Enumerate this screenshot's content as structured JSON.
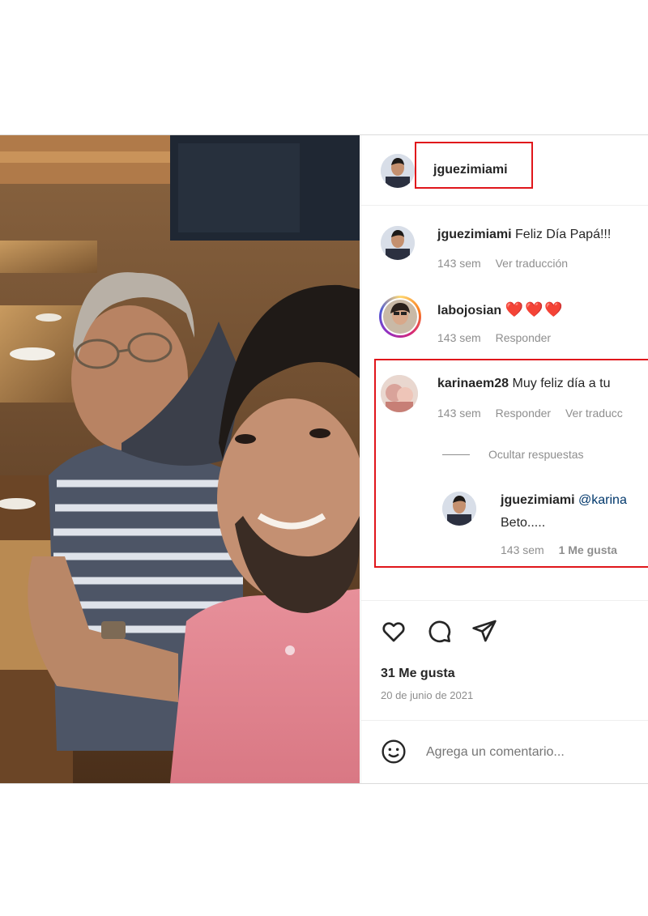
{
  "header": {
    "username": "jguezimiami"
  },
  "caption": {
    "username": "jguezimiami",
    "text": "Feliz Día Papá!!!",
    "time": "143 sem",
    "translate": "Ver traducción"
  },
  "comments": [
    {
      "username": "labojosian",
      "text": "❤️❤️❤️",
      "time": "143 sem",
      "reply": "Responder"
    },
    {
      "username": "karinaem28",
      "text": "Muy feliz día a tu",
      "time": "143 sem",
      "reply": "Responder",
      "translate": "Ver traducc"
    }
  ],
  "replies_toggle": "Ocultar respuestas",
  "reply": {
    "username": "jguezimiami",
    "mention": "@karina",
    "text": "Beto.....",
    "time": "143 sem",
    "likes": "1 Me gusta"
  },
  "post": {
    "likes": "31 Me gusta",
    "date": "20 de junio de 2021"
  },
  "comment_input": {
    "placeholder": "Agrega un comentario..."
  },
  "icons": [
    "heart-icon",
    "comment-icon",
    "share-icon",
    "emoji-icon"
  ],
  "colors": {
    "highlight": "#e0161b",
    "muted_text": "#8e8e8e",
    "link": "#00376b",
    "story_ring": "#d62976"
  }
}
